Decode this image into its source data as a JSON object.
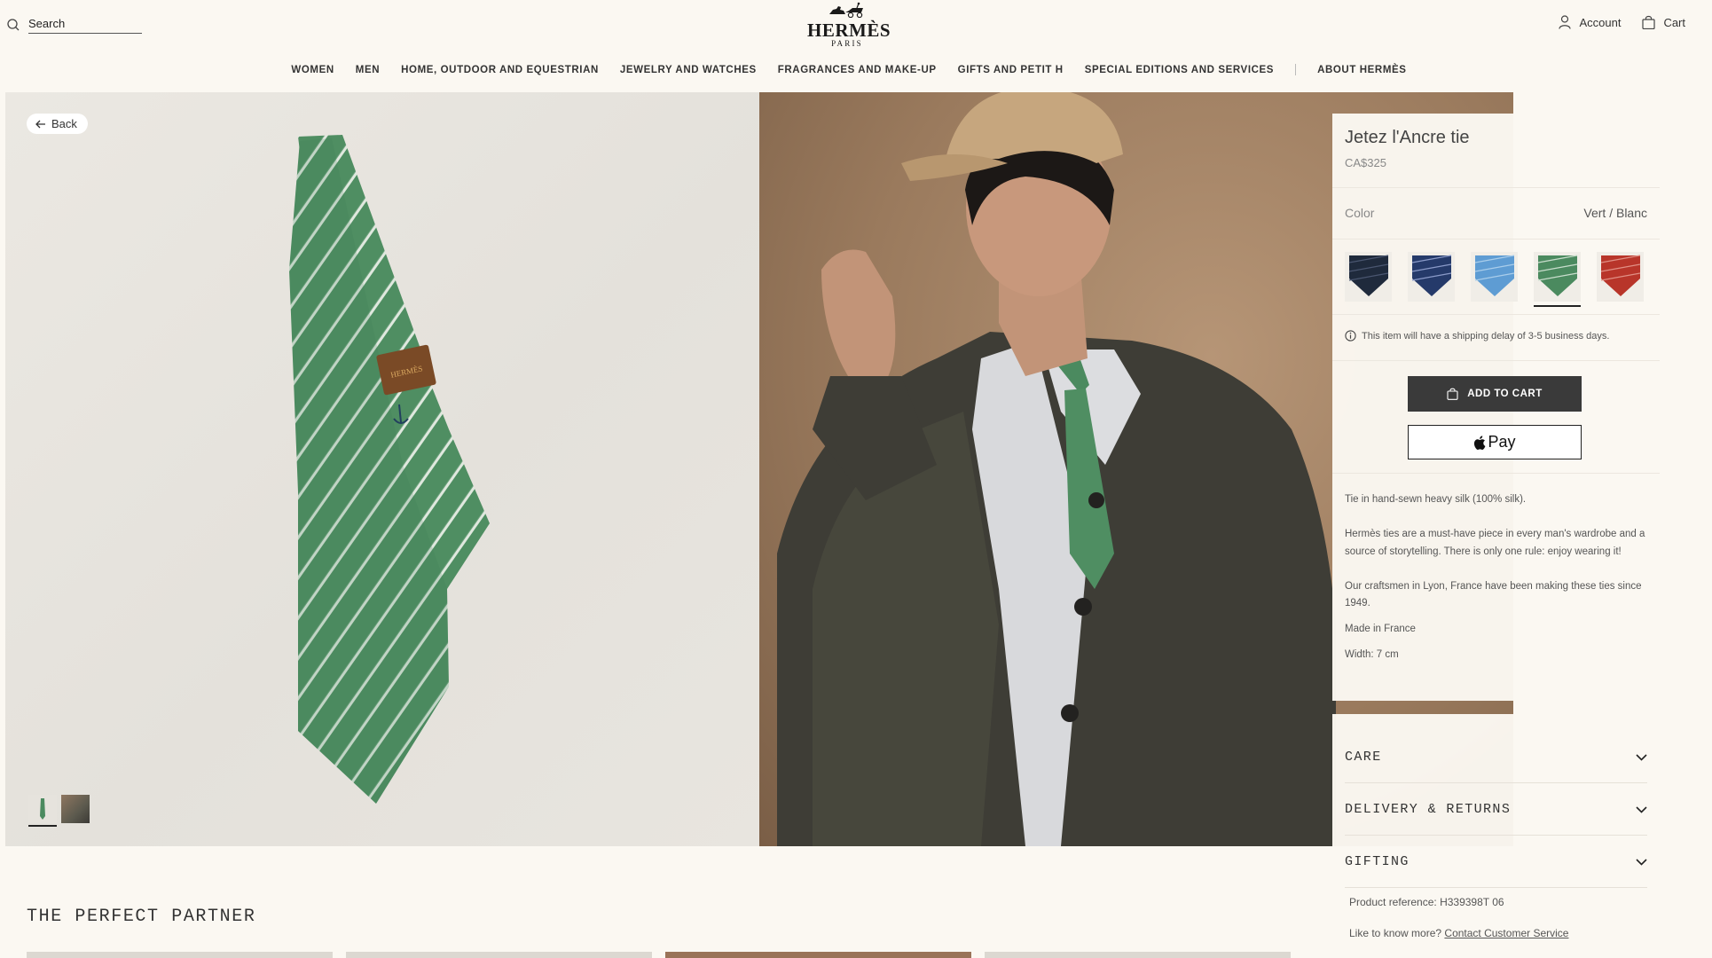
{
  "header": {
    "search_placeholder": "Search",
    "logo_name": "HERMÈS",
    "logo_city": "PARIS",
    "account_label": "Account",
    "cart_label": "Cart"
  },
  "nav": {
    "items": [
      "WOMEN",
      "MEN",
      "HOME, OUTDOOR AND EQUESTRIAN",
      "JEWELRY AND WATCHES",
      "FRAGRANCES AND MAKE-UP",
      "GIFTS AND PETIT H",
      "SPECIAL EDITIONS AND SERVICES"
    ],
    "about_label": "ABOUT HERMÈS"
  },
  "gallery": {
    "back_label": "Back"
  },
  "product": {
    "title": "Jetez l'Ancre tie",
    "price": "CA$325",
    "color_label": "Color",
    "color_value": "Vert / Blanc",
    "swatches": [
      {
        "name": "navy-dark",
        "color": "#1f2a3c"
      },
      {
        "name": "navy-stripe",
        "color": "#253a6a"
      },
      {
        "name": "sky-blue",
        "color": "#5e9cd3"
      },
      {
        "name": "vert",
        "color": "#4b8a5f",
        "selected": true
      },
      {
        "name": "red",
        "color": "#b8352a"
      }
    ],
    "shipping_note": "This item will have a shipping delay of 3-5 business days.",
    "add_to_cart_label": "ADD TO CART",
    "pay_label": "Pay",
    "description": [
      "Tie in hand-sewn heavy silk (100% silk).",
      "Hermès ties are a must-have piece in every man's wardrobe and a source of storytelling. There is only one rule: enjoy wearing it!",
      "Our craftsmen in Lyon, France have been making these ties since 1949.",
      "Made in France",
      "Width: 7 cm"
    ]
  },
  "accordion": {
    "care": "CARE",
    "delivery": "DELIVERY & RETURNS",
    "gifting": "GIFTING"
  },
  "reference": {
    "label": "Product reference:",
    "value": "H339398T 06",
    "know_more": "Like to know more?",
    "contact": "Contact Customer Service"
  },
  "section": {
    "title": "THE PERFECT PARTNER"
  },
  "colors": {
    "background": "#fbf8f2",
    "tie_green": "#4b8a5f",
    "button_dark": "#3a3a3a"
  }
}
